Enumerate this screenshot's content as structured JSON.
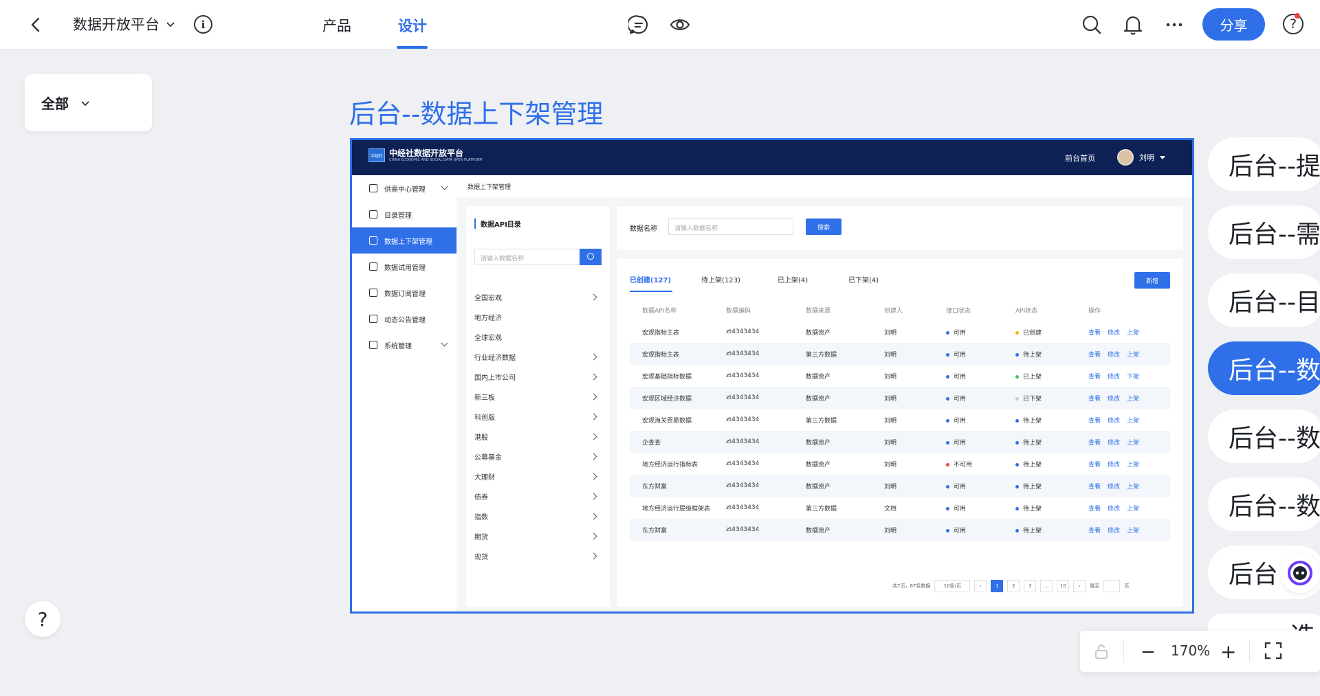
{
  "topbar": {
    "project_name": "数据开放平台",
    "tabs": [
      "产品",
      "设计"
    ],
    "share_label": "分享",
    "help_label": "?"
  },
  "filter": {
    "label": "全部"
  },
  "page_title": "后台--数据上下架管理",
  "app": {
    "logo_mark": "中经社",
    "logo_title": "中经社数据开放平台",
    "logo_subtitle": "CHINA ECONOMIC AND SOCIAL DATA OPEN PLATFORM",
    "home_link": "前台首页",
    "user_name": "刘明",
    "breadcrumb": "数据上下架管理",
    "nav": [
      {
        "label": "供需中心管理",
        "expandable": true
      },
      {
        "label": "目录管理",
        "expandable": false
      },
      {
        "label": "数据上下架管理",
        "expandable": false,
        "active": true
      },
      {
        "label": "数据试用管理",
        "expandable": false
      },
      {
        "label": "数据订阅管理",
        "expandable": false
      },
      {
        "label": "动态公告管理",
        "expandable": false
      },
      {
        "label": "系统管理",
        "expandable": true
      }
    ],
    "catalog": {
      "title": "数据API目录",
      "search_placeholder": "请输入数据名称",
      "items": [
        {
          "label": "全国宏观",
          "arrow": true
        },
        {
          "label": "地方经济",
          "arrow": false
        },
        {
          "label": "全球宏观",
          "arrow": false
        },
        {
          "label": "行业经济数据",
          "arrow": true
        },
        {
          "label": "国内上市公司",
          "arrow": true
        },
        {
          "label": "新三板",
          "arrow": true
        },
        {
          "label": "科创版",
          "arrow": true
        },
        {
          "label": "港股",
          "arrow": true
        },
        {
          "label": "公募基金",
          "arrow": true
        },
        {
          "label": "大理财",
          "arrow": true
        },
        {
          "label": "债券",
          "arrow": true
        },
        {
          "label": "指数",
          "arrow": true
        },
        {
          "label": "期货",
          "arrow": true
        },
        {
          "label": "现货",
          "arrow": true
        }
      ]
    },
    "search": {
      "label": "数据名称",
      "placeholder": "请输入数据名称",
      "button": "搜索"
    },
    "status_tabs": [
      "已创建(127)",
      "待上架(123)",
      "已上架(4)",
      "已下架(4)"
    ],
    "new_button": "新增",
    "table": {
      "headers": [
        "数据API名称",
        "数据编码",
        "数据来源",
        "创建人",
        "接口状态",
        "API状态",
        "操作"
      ],
      "rows": [
        {
          "name": "宏观指标主表",
          "code": "zt4343434",
          "source": "数据资产",
          "creator": "刘明",
          "iface": "可用",
          "iface_color": "#2f6fe8",
          "api": "已创建",
          "api_color": "#f5b400",
          "ops": [
            "查看",
            "修改",
            "上架"
          ]
        },
        {
          "name": "宏观指标主表",
          "code": "zt4343434",
          "source": "第三方数据",
          "creator": "刘明",
          "iface": "可用",
          "iface_color": "#2f6fe8",
          "api": "待上架",
          "api_color": "#2f6fe8",
          "ops": [
            "查看",
            "修改",
            "上架"
          ]
        },
        {
          "name": "宏观基础指标数据",
          "code": "zt4343434",
          "source": "数据资产",
          "creator": "刘明",
          "iface": "可用",
          "iface_color": "#2f6fe8",
          "api": "已上架",
          "api_color": "#3cc46b",
          "ops": [
            "查看",
            "修改",
            "下架"
          ]
        },
        {
          "name": "宏观区域经济数据",
          "code": "zt4343434",
          "source": "数据资产",
          "creator": "刘明",
          "iface": "可用",
          "iface_color": "#2f6fe8",
          "api": "已下架",
          "api_color": "#c8ccd4",
          "ops": [
            "查看",
            "修改",
            "上架"
          ]
        },
        {
          "name": "宏观海关贸易数据",
          "code": "zt4343434",
          "source": "第三方数据",
          "creator": "刘明",
          "iface": "可用",
          "iface_color": "#2f6fe8",
          "api": "待上架",
          "api_color": "#2f6fe8",
          "ops": [
            "查看",
            "修改",
            "上架"
          ]
        },
        {
          "name": "企查查",
          "code": "zt4343434",
          "source": "数据资产",
          "creator": "刘明",
          "iface": "可用",
          "iface_color": "#2f6fe8",
          "api": "待上架",
          "api_color": "#2f6fe8",
          "ops": [
            "查看",
            "修改",
            "上架"
          ]
        },
        {
          "name": "地方经济运行指标表",
          "code": "zt4343434",
          "source": "数据资产",
          "creator": "刘明",
          "iface": "不可用",
          "iface_color": "#f0443e",
          "api": "待上架",
          "api_color": "#2f6fe8",
          "ops": [
            "查看",
            "修改",
            "上架"
          ]
        },
        {
          "name": "东方财富",
          "code": "zt4343434",
          "source": "数据资产",
          "creator": "刘明",
          "iface": "可用",
          "iface_color": "#2f6fe8",
          "api": "待上架",
          "api_color": "#2f6fe8",
          "ops": [
            "查看",
            "修改",
            "上架"
          ]
        },
        {
          "name": "地方经济运行层级框架表",
          "code": "zt4343434",
          "source": "第三方数据",
          "creator": "文档",
          "iface": "可用",
          "iface_color": "#2f6fe8",
          "api": "待上架",
          "api_color": "#2f6fe8",
          "ops": [
            "查看",
            "修改",
            "上架"
          ]
        },
        {
          "name": "东方财富",
          "code": "zt4343434",
          "source": "数据资产",
          "creator": "刘明",
          "iface": "可用",
          "iface_color": "#2f6fe8",
          "api": "待上架",
          "api_color": "#2f6fe8",
          "ops": [
            "查看",
            "修改",
            "上架"
          ]
        }
      ]
    },
    "pager": {
      "summary": "共7页，67条数据",
      "size": "10条/页",
      "pages": [
        "1",
        "2",
        "3",
        "...",
        "10"
      ],
      "current": "1",
      "jump_label": "跳至",
      "jump_unit": "页"
    }
  },
  "page_list": [
    "后台--提",
    "后台--需",
    "后台--目",
    "后台--数",
    "后台--数",
    "后台--数",
    "后台",
    "选"
  ],
  "page_list_active_index": 3,
  "zoom": {
    "value": "170%",
    "minus": "−",
    "plus": "+"
  }
}
